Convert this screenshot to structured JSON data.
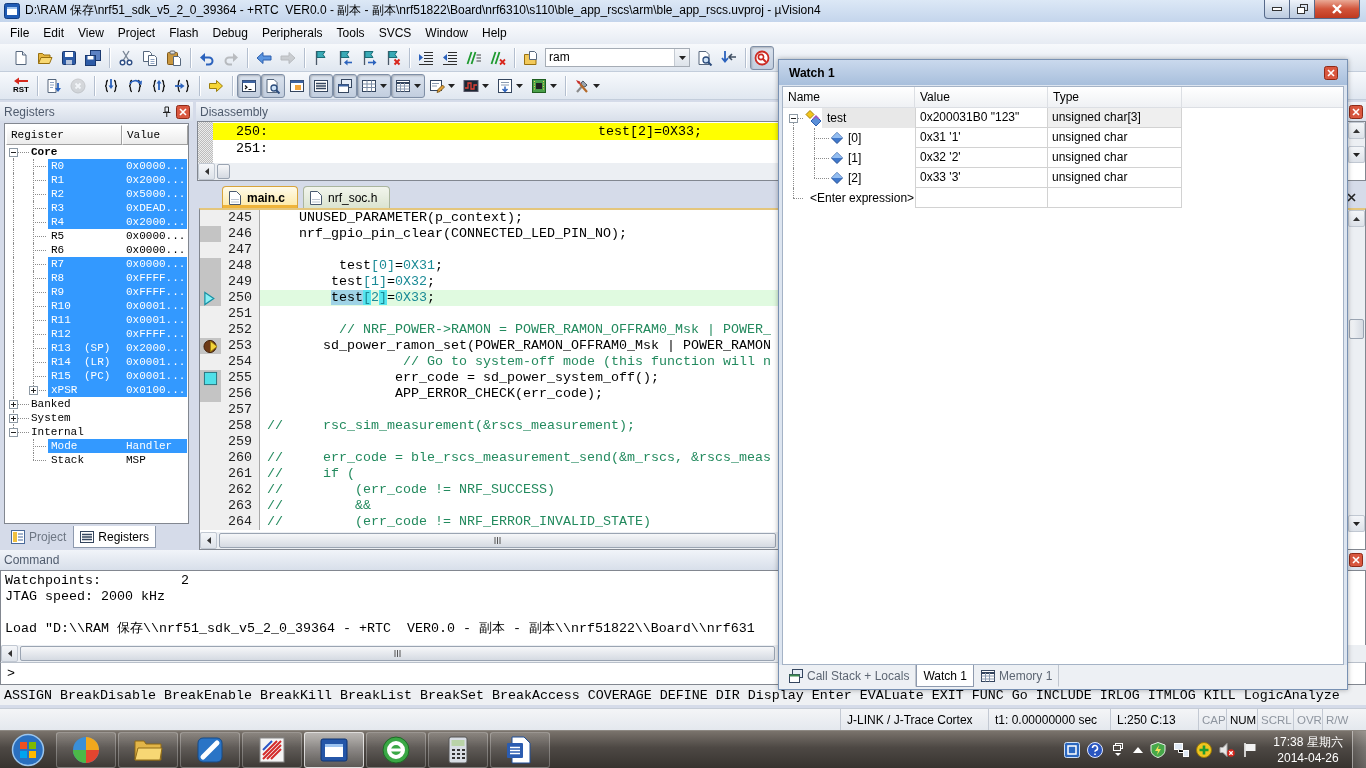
{
  "window": {
    "title": "D:\\RAM 保存\\nrf51_sdk_v5_2_0_39364 - +RTC  VER0.0 - 副本 - 副本\\nrf51822\\Board\\nrf6310\\s110\\ble_app_rscs\\arm\\ble_app_rscs.uvproj - µVision4"
  },
  "menu": [
    "File",
    "Edit",
    "View",
    "Project",
    "Flash",
    "Debug",
    "Peripherals",
    "Tools",
    "SVCS",
    "Window",
    "Help"
  ],
  "toolbars": [
    {
      "items": [
        {
          "kind": "page",
          "pressed": false,
          "disabled": false
        },
        {
          "kind": "folder",
          "pressed": false,
          "disabled": false
        },
        {
          "kind": "floppy",
          "pressed": false,
          "disabled": false
        },
        {
          "kind": "floppies",
          "pressed": false,
          "disabled": false
        },
        {
          "kind": "separator"
        },
        {
          "kind": "scissors",
          "pressed": false,
          "disabled": false
        },
        {
          "kind": "copy",
          "pressed": false,
          "disabled": false
        },
        {
          "kind": "clipboard",
          "pressed": false,
          "disabled": false
        },
        {
          "kind": "separator"
        },
        {
          "kind": "undo",
          "pressed": false,
          "disabled": false
        },
        {
          "kind": "redo",
          "pressed": false,
          "disabled": true
        },
        {
          "kind": "separator"
        },
        {
          "kind": "back",
          "pressed": false,
          "disabled": false
        },
        {
          "kind": "forward",
          "pressed": false,
          "disabled": true
        },
        {
          "kind": "separator"
        },
        {
          "kind": "flag",
          "pressed": false,
          "disabled": false
        },
        {
          "kind": "flagprev",
          "pressed": false,
          "disabled": false
        },
        {
          "kind": "flagnext",
          "pressed": false,
          "disabled": false
        },
        {
          "kind": "flagclear",
          "pressed": false,
          "disabled": false
        },
        {
          "kind": "separator"
        },
        {
          "kind": "indent",
          "pressed": false,
          "disabled": false
        },
        {
          "kind": "outdent",
          "pressed": false,
          "disabled": false
        },
        {
          "kind": "comment",
          "pressed": false,
          "disabled": false
        },
        {
          "kind": "uncomment",
          "pressed": false,
          "disabled": false
        },
        {
          "kind": "separator"
        },
        {
          "kind": "findfiles",
          "pressed": false,
          "disabled": false
        },
        {
          "kind": "combo",
          "value": "ram"
        },
        {
          "kind": "find",
          "pressed": false,
          "disabled": false
        },
        {
          "kind": "findnext",
          "pressed": false,
          "disabled": false
        },
        {
          "kind": "separator"
        },
        {
          "kind": "debug",
          "pressed": true,
          "disabled": false
        }
      ]
    },
    {
      "items": [
        {
          "kind": "reset",
          "label": "RST",
          "pressed": false,
          "disabled": false
        },
        {
          "kind": "separator"
        },
        {
          "kind": "run",
          "pressed": false,
          "disabled": false
        },
        {
          "kind": "stop",
          "pressed": false,
          "disabled": true
        },
        {
          "kind": "separator"
        },
        {
          "kind": "stepin",
          "pressed": false,
          "disabled": false
        },
        {
          "kind": "stepover",
          "pressed": false,
          "disabled": false
        },
        {
          "kind": "stepout",
          "pressed": false,
          "disabled": false
        },
        {
          "kind": "runto",
          "pressed": false,
          "disabled": false
        },
        {
          "kind": "separator"
        },
        {
          "kind": "shownext",
          "pressed": false,
          "disabled": false
        },
        {
          "kind": "separator"
        },
        {
          "kind": "cmd",
          "pressed": true,
          "disabled": false
        },
        {
          "kind": "disasm",
          "pressed": true,
          "disabled": false
        },
        {
          "kind": "symbols",
          "pressed": false,
          "disabled": false
        },
        {
          "kind": "registers",
          "pressed": true,
          "disabled": false
        },
        {
          "kind": "callstack",
          "pressed": true,
          "disabled": false
        },
        {
          "kind": "watch",
          "pressed": true,
          "disabled": false,
          "dropdown": true
        },
        {
          "kind": "memory",
          "pressed": true,
          "disabled": false,
          "dropdown": true
        },
        {
          "kind": "serial",
          "pressed": false,
          "disabled": false,
          "dropdown": true
        },
        {
          "kind": "analysis",
          "pressed": false,
          "disabled": false,
          "dropdown": true
        },
        {
          "kind": "trace",
          "pressed": false,
          "disabled": false,
          "dropdown": true
        },
        {
          "kind": "sysviewer",
          "pressed": false,
          "disabled": false,
          "dropdown": true
        },
        {
          "kind": "separator"
        },
        {
          "kind": "tools",
          "pressed": false,
          "disabled": false,
          "dropdown": true
        }
      ]
    }
  ],
  "registers_panel": {
    "title": "Registers",
    "columns": [
      "Register",
      "Value"
    ],
    "tree": [
      {
        "name": "Core",
        "bold": true,
        "expanded": true,
        "children": [
          {
            "name": "R0",
            "value": "0x0000...",
            "highlighted": true
          },
          {
            "name": "R1",
            "value": "0x2000...",
            "highlighted": true
          },
          {
            "name": "R2",
            "value": "0x5000...",
            "highlighted": true
          },
          {
            "name": "R3",
            "value": "0xDEAD...",
            "highlighted": true
          },
          {
            "name": "R4",
            "value": "0x2000...",
            "highlighted": true
          },
          {
            "name": "R5",
            "value": "0x0000...",
            "highlighted": false
          },
          {
            "name": "R6",
            "value": "0x0000...",
            "highlighted": false
          },
          {
            "name": "R7",
            "value": "0x0000...",
            "highlighted": true
          },
          {
            "name": "R8",
            "value": "0xFFFF...",
            "highlighted": true
          },
          {
            "name": "R9",
            "value": "0xFFFF...",
            "highlighted": true
          },
          {
            "name": "R10",
            "value": "0x0001...",
            "highlighted": true
          },
          {
            "name": "R11",
            "value": "0x0001...",
            "highlighted": true
          },
          {
            "name": "R12",
            "value": "0xFFFF...",
            "highlighted": true
          },
          {
            "name": "R13  (SP)",
            "value": "0x2000...",
            "highlighted": true
          },
          {
            "name": "R14  (LR)",
            "value": "0x0001...",
            "highlighted": true
          },
          {
            "name": "R15  (PC)",
            "value": "0x0001...",
            "highlighted": true
          },
          {
            "name": "xPSR",
            "value": "0x0100...",
            "highlighted": true,
            "expanded": false
          }
        ]
      },
      {
        "name": "Banked",
        "bold": false,
        "expanded": false
      },
      {
        "name": "System",
        "bold": false,
        "expanded": false
      },
      {
        "name": "Internal",
        "bold": false,
        "expanded": true,
        "children": [
          {
            "name": "Mode",
            "value": "Handler",
            "highlighted": true
          },
          {
            "name": "Stack",
            "value": "MSP",
            "highlighted": false
          }
        ]
      }
    ],
    "tabs": [
      {
        "label": "Project",
        "kind": "project",
        "selected": false
      },
      {
        "label": "Registers",
        "kind": "registers",
        "selected": true
      }
    ]
  },
  "disassembly": {
    "title": "Disassembly",
    "lines": [
      {
        "number": "250:",
        "source": "test[2]=0X33;",
        "current": true
      },
      {
        "number": "251:",
        "current": false
      }
    ]
  },
  "editor": {
    "tabs": [
      {
        "label": "main.c",
        "selected": true
      },
      {
        "label": "nrf_soc.h",
        "selected": false
      }
    ],
    "lines": [
      {
        "number": "245",
        "kind": "code",
        "text": "    UNUSED_PARAMETER(p_context);",
        "executable": false,
        "current": false
      },
      {
        "number": "246",
        "kind": "code",
        "text": "    nrf_gpio_pin_clear(CONNECTED_LED_PIN_NO);",
        "executable": true,
        "current": false
      },
      {
        "number": "247",
        "kind": "blank",
        "executable": false,
        "current": false
      },
      {
        "number": "248",
        "kind": "code",
        "text": "         test[0]=0X31;",
        "executable": true,
        "current": false
      },
      {
        "number": "249",
        "kind": "code",
        "text": "        test[1]=0X32;",
        "executable": true,
        "current": false
      },
      {
        "number": "250",
        "kind": "code",
        "segments": [
          {
            "text": "        test",
            "kind": "selection"
          },
          {
            "text": "[",
            "kind": "brace"
          },
          {
            "text": "2",
            "kind": "plain"
          },
          {
            "text": "]",
            "kind": "brace"
          },
          {
            "text": "=0X33;",
            "kind": "plain"
          }
        ],
        "executable": true,
        "current": true,
        "marker": {
          "kind": "arrow"
        }
      },
      {
        "number": "251",
        "kind": "blank",
        "executable": false,
        "current": false
      },
      {
        "number": "252",
        "kind": "comment",
        "text": "         // NRF_POWER->RAMON = POWER_RAMON_OFFRAM0_Msk | POWER_",
        "executable": false,
        "current": false
      },
      {
        "number": "253",
        "kind": "code",
        "text": "       sd_power_ramon_set(POWER_RAMON_OFFRAM0_Msk | POWER_RAMON",
        "executable": true,
        "current": false,
        "marker": {
          "kind": "frame"
        }
      },
      {
        "number": "254",
        "kind": "comment",
        "text": "                 // Go to system-off mode (this function will n",
        "executable": false,
        "current": false
      },
      {
        "number": "255",
        "kind": "code",
        "text": "                err_code = sd_power_system_off();",
        "executable": true,
        "current": false,
        "marker": {
          "kind": "bookmark"
        }
      },
      {
        "number": "256",
        "kind": "code",
        "text": "                APP_ERROR_CHECK(err_code);",
        "executable": true,
        "current": false
      },
      {
        "number": "257",
        "kind": "blank",
        "executable": false,
        "current": false
      },
      {
        "number": "258",
        "kind": "comment",
        "text": "//     rsc_sim_measurement(&rscs_measurement);",
        "executable": false,
        "current": false
      },
      {
        "number": "259",
        "kind": "blank",
        "executable": false,
        "current": false
      },
      {
        "number": "260",
        "kind": "comment",
        "text": "//     err_code = ble_rscs_measurement_send(&m_rscs, &rscs_meas",
        "executable": false,
        "current": false
      },
      {
        "number": "261",
        "kind": "comment",
        "text": "//     if (",
        "executable": false,
        "current": false
      },
      {
        "number": "262",
        "kind": "comment",
        "text": "//         (err_code != NRF_SUCCESS)",
        "executable": false,
        "current": false
      },
      {
        "number": "263",
        "kind": "comment",
        "text": "//         &&",
        "executable": false,
        "current": false
      },
      {
        "number": "264",
        "kind": "comment",
        "text": "//         (err_code != NRF_ERROR_INVALID_STATE)",
        "executable": false,
        "current": false
      }
    ]
  },
  "command_panel": {
    "title": "Command",
    "lines": [
      {
        "kind": "text",
        "text": "Watchpoints:          2"
      },
      {
        "kind": "text",
        "text": "JTAG speed: 2000 kHz"
      },
      {
        "kind": "blank"
      },
      {
        "kind": "text",
        "text": "Load \"D:\\\\RAM 保存\\\\nrf51_sdk_v5_2_0_39364 - +RTC  VER0.0 - 副本 - 副本\\\\nrf51822\\\\Board\\\\nrf631"
      }
    ],
    "prompt": ">",
    "keywords": "ASSIGN BreakDisable BreakEnable BreakKill BreakList BreakSet BreakAccess COVERAGE DEFINE DIR Display Enter EVALuate EXIT FUNC Go INCLUDE IRLOG ITMLOG KILL LogicAnalyze"
  },
  "status_bar": {
    "target": "J-LINK / J-Trace Cortex",
    "time": "t1: 0.00000000 sec",
    "position": "L:250 C:13",
    "indicators": [
      {
        "label": "CAP",
        "on": false
      },
      {
        "label": "NUM",
        "on": true
      },
      {
        "label": "SCRL",
        "on": false
      },
      {
        "label": "OVR",
        "on": false
      },
      {
        "label": "R/W",
        "on": false
      }
    ]
  },
  "watch_window": {
    "title": "Watch 1",
    "columns": [
      "Name",
      "Value",
      "Type"
    ],
    "rows": [
      {
        "name": "test",
        "value": "0x200031B0 \"123\"",
        "type": "unsigned char[3]",
        "expanded": true,
        "selected": true,
        "children": [
          {
            "name": "[0]",
            "value": "0x31 '1'",
            "type": "unsigned char",
            "selected": false
          },
          {
            "name": "[1]",
            "value": "0x32 '2'",
            "type": "unsigned char",
            "selected": false
          },
          {
            "name": "[2]",
            "value": "0x33 '3'",
            "type": "unsigned char",
            "selected": false
          }
        ]
      }
    ],
    "entry_row": {
      "label": "<Enter expression>"
    },
    "tabs": [
      {
        "label": "Call Stack + Locals",
        "kind": "callstack",
        "selected": false
      },
      {
        "label": "Watch 1",
        "kind": "watch",
        "selected": true
      },
      {
        "label": "Memory 1",
        "kind": "memory",
        "selected": false
      }
    ]
  },
  "taskbar": {
    "apps": [
      {
        "kind": "ball",
        "active": false
      },
      {
        "kind": "folder",
        "active": false
      },
      {
        "kind": "tile",
        "active": false
      },
      {
        "kind": "stripes",
        "active": false
      },
      {
        "kind": "window",
        "active": true
      },
      {
        "kind": "ring",
        "active": false
      },
      {
        "kind": "calculator",
        "active": false
      },
      {
        "kind": "document",
        "active": false
      }
    ],
    "clock": {
      "time": "17:38 星期六",
      "date": "2014-04-26"
    }
  }
}
